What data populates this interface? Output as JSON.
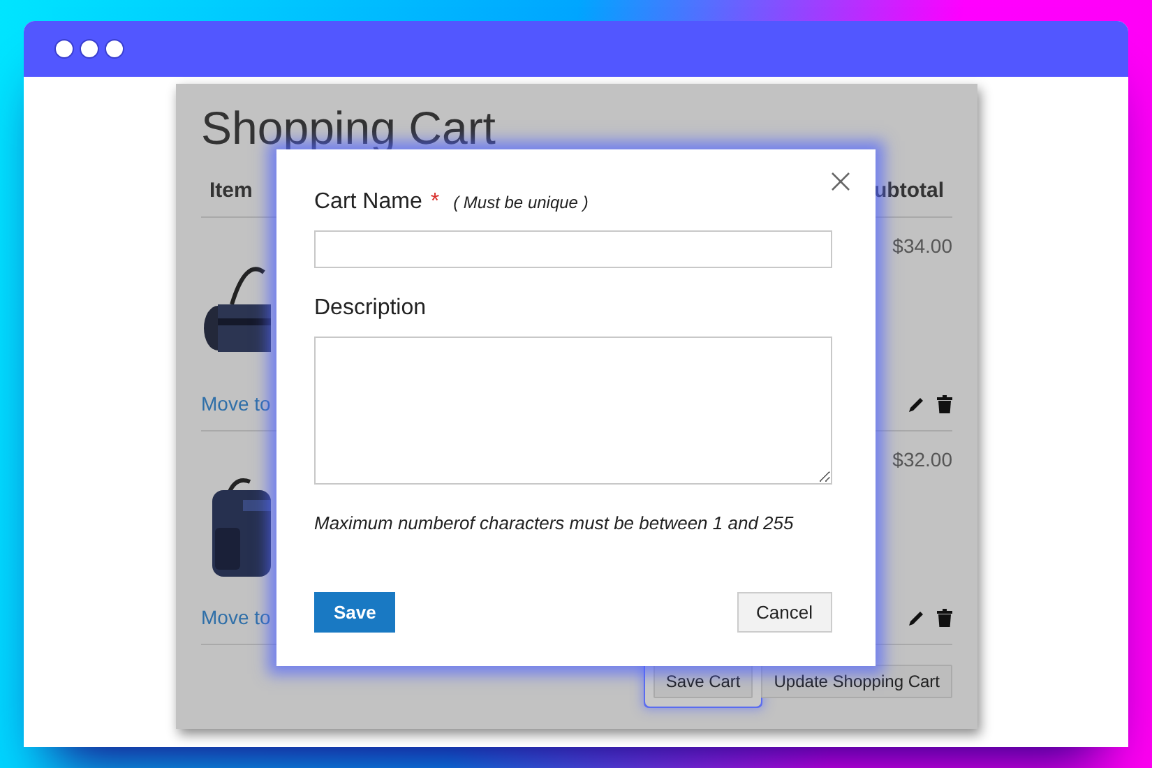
{
  "cart": {
    "title": "Shopping Cart",
    "columns": [
      "Item",
      "ubtotal"
    ],
    "items": [
      {
        "subtotal": "$34.00",
        "action": "Move to"
      },
      {
        "subtotal": "$32.00",
        "action": "Move to"
      }
    ],
    "buttons": [
      {
        "label": "Save Cart",
        "focused": true
      },
      {
        "label": "Update Shopping Cart",
        "focused": false
      }
    ]
  },
  "dialog": {
    "fields": [
      {
        "label": "Cart Name",
        "required_mark": "*",
        "hint": "( Must be unique )",
        "kind": "input"
      },
      {
        "label": "Description",
        "kind": "textarea"
      }
    ],
    "note": "Maximum numberof characters must be between 1 and 255",
    "buttons": [
      {
        "label": "Save",
        "kind": "primary"
      },
      {
        "label": "Cancel",
        "kind": "secondary"
      }
    ]
  }
}
